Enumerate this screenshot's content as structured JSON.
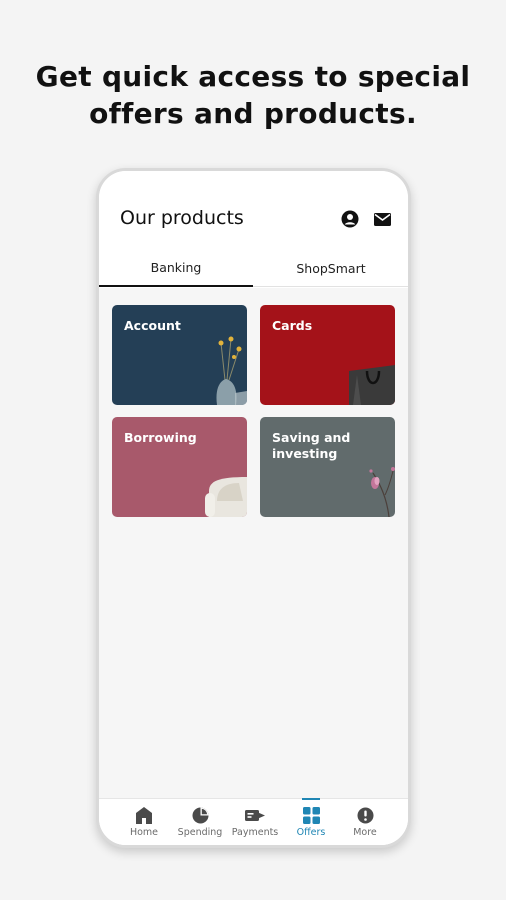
{
  "headline": {
    "line1": "Get quick access to special",
    "line2": "offers and products."
  },
  "app": {
    "title": "Our products",
    "icons": {
      "profile": "person-circle-icon",
      "messages": "envelope-icon"
    },
    "tabs": [
      {
        "label": "Banking",
        "active": true
      },
      {
        "label": "ShopSmart",
        "active": false
      }
    ],
    "cards": [
      {
        "label": "Account",
        "color": "#243f56"
      },
      {
        "label": "Cards",
        "color": "#a41219"
      },
      {
        "label": "Borrowing",
        "color": "#a8596b"
      },
      {
        "label": "Saving and investing",
        "color": "#616b6c"
      }
    ],
    "nav": [
      {
        "label": "Home",
        "icon": "home-icon"
      },
      {
        "label": "Spending",
        "icon": "pie-chart-icon"
      },
      {
        "label": "Payments",
        "icon": "payments-icon"
      },
      {
        "label": "Offers",
        "icon": "offers-grid-icon",
        "active": true
      },
      {
        "label": "More",
        "icon": "more-icon"
      }
    ],
    "accent": "#1f86b4"
  }
}
